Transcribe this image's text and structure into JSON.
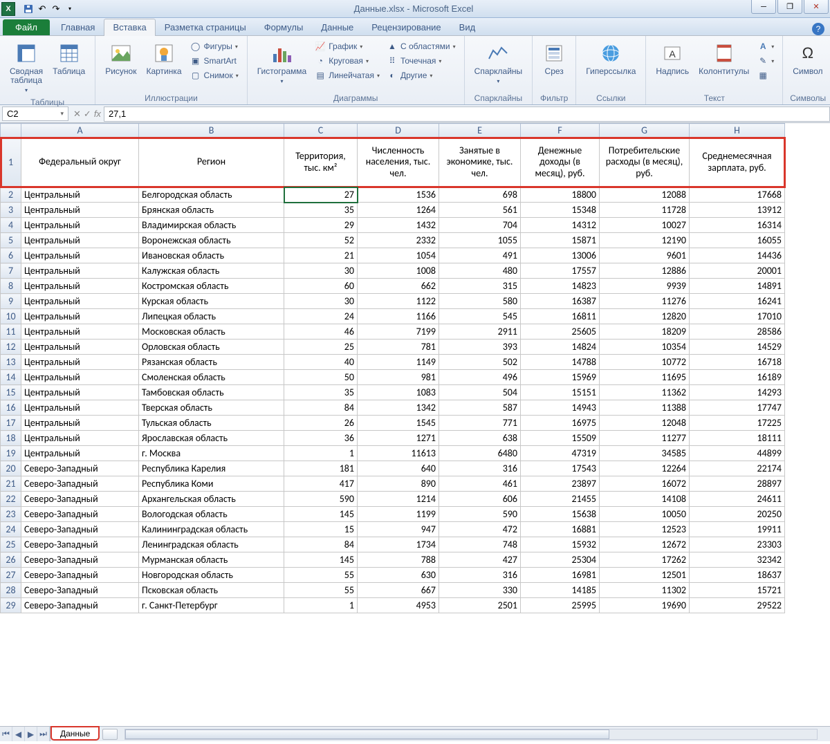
{
  "title": "Данные.xlsx - Microsoft Excel",
  "qat": {
    "save": "save-icon",
    "undo": "undo-icon",
    "redo": "redo-icon"
  },
  "tabs": {
    "file": "Файл",
    "items": [
      "Главная",
      "Вставка",
      "Разметка страницы",
      "Формулы",
      "Данные",
      "Рецензирование",
      "Вид"
    ],
    "active": 1
  },
  "ribbon": {
    "tables": {
      "label": "Таблицы",
      "pivot": "Сводная таблица",
      "table": "Таблица"
    },
    "illustr": {
      "label": "Иллюстрации",
      "picture": "Рисунок",
      "clipart": "Картинка",
      "shapes": "Фигуры",
      "smartart": "SmartArt",
      "screenshot": "Снимок"
    },
    "charts": {
      "label": "Диаграммы",
      "column": "Гистограмма",
      "line_chart": "График",
      "pie": "Круговая",
      "bar": "Линейчатая",
      "area": "С областями",
      "scatter": "Точечная",
      "other": "Другие"
    },
    "spark": {
      "label": "Спарклайны",
      "btn": "Спарклайны"
    },
    "filter": {
      "label": "Фильтр",
      "slicer": "Срез"
    },
    "links": {
      "label": "Ссылки",
      "hyperlink": "Гиперссылка"
    },
    "text": {
      "label": "Текст",
      "textbox": "Надпись",
      "headerfooter": "Колонтитулы"
    },
    "symbols": {
      "label": "Символы",
      "symbol": "Символ"
    }
  },
  "fbar": {
    "cell": "C2",
    "value": "27,1"
  },
  "cols": [
    "A",
    "B",
    "C",
    "D",
    "E",
    "F",
    "G",
    "H"
  ],
  "headers": [
    "Федеральный округ",
    "Регион",
    "Территория, тыс. км²",
    "Численность населения, тыс. чел.",
    "Занятые в экономике, тыс. чел.",
    "Денежные доходы (в месяц), руб.",
    "Потребительские расходы (в месяц), руб.",
    "Среднемесячная зарплата, руб."
  ],
  "rows": [
    [
      "Центральный",
      "Белгородская область",
      27,
      1536,
      698,
      18800,
      12088,
      17668
    ],
    [
      "Центральный",
      "Брянская область",
      35,
      1264,
      561,
      15348,
      11728,
      13912
    ],
    [
      "Центральный",
      "Владимирская область",
      29,
      1432,
      704,
      14312,
      10027,
      16314
    ],
    [
      "Центральный",
      "Воронежская область",
      52,
      2332,
      1055,
      15871,
      12190,
      16055
    ],
    [
      "Центральный",
      "Ивановская область",
      21,
      1054,
      491,
      13006,
      9601,
      14436
    ],
    [
      "Центральный",
      "Калужская область",
      30,
      1008,
      480,
      17557,
      12886,
      20001
    ],
    [
      "Центральный",
      "Костромская область",
      60,
      662,
      315,
      14823,
      9939,
      14891
    ],
    [
      "Центральный",
      "Курская область",
      30,
      1122,
      580,
      16387,
      11276,
      16241
    ],
    [
      "Центральный",
      "Липецкая область",
      24,
      1166,
      545,
      16811,
      12820,
      17010
    ],
    [
      "Центральный",
      "Московская область",
      46,
      7199,
      2911,
      25605,
      18209,
      28586
    ],
    [
      "Центральный",
      "Орловская область",
      25,
      781,
      393,
      14824,
      10354,
      14529
    ],
    [
      "Центральный",
      "Рязанская область",
      40,
      1149,
      502,
      14788,
      10772,
      16718
    ],
    [
      "Центральный",
      "Смоленская область",
      50,
      981,
      496,
      15969,
      11695,
      16189
    ],
    [
      "Центральный",
      "Тамбовская область",
      35,
      1083,
      504,
      15151,
      11362,
      14293
    ],
    [
      "Центральный",
      "Тверская область",
      84,
      1342,
      587,
      14943,
      11388,
      17747
    ],
    [
      "Центральный",
      "Тульская область",
      26,
      1545,
      771,
      16975,
      12048,
      17225
    ],
    [
      "Центральный",
      "Ярославская область",
      36,
      1271,
      638,
      15509,
      11277,
      18111
    ],
    [
      "Центральный",
      "г. Москва",
      1,
      11613,
      6480,
      47319,
      34585,
      44899
    ],
    [
      "Северо-Западный",
      "Республика Карелия",
      181,
      640,
      316,
      17543,
      12264,
      22174
    ],
    [
      "Северо-Западный",
      "Республика Коми",
      417,
      890,
      461,
      23897,
      16072,
      28897
    ],
    [
      "Северо-Западный",
      "Архангельская область",
      590,
      1214,
      606,
      21455,
      14108,
      24611
    ],
    [
      "Северо-Западный",
      "Вологодская область",
      145,
      1199,
      590,
      15638,
      10050,
      20250
    ],
    [
      "Северо-Западный",
      "Калининградская область",
      15,
      947,
      472,
      16881,
      12523,
      19911
    ],
    [
      "Северо-Западный",
      "Ленинградская область",
      84,
      1734,
      748,
      15932,
      12672,
      23303
    ],
    [
      "Северо-Западный",
      "Мурманская область",
      145,
      788,
      427,
      25304,
      17262,
      32342
    ],
    [
      "Северо-Западный",
      "Новгородская область",
      55,
      630,
      316,
      16981,
      12501,
      18637
    ],
    [
      "Северо-Западный",
      "Псковская область",
      55,
      667,
      330,
      14185,
      11302,
      15721
    ],
    [
      "Северо-Западный",
      "г. Санкт-Петербург",
      1,
      4953,
      2501,
      25995,
      19690,
      29522
    ]
  ],
  "sheet_tab": "Данные"
}
